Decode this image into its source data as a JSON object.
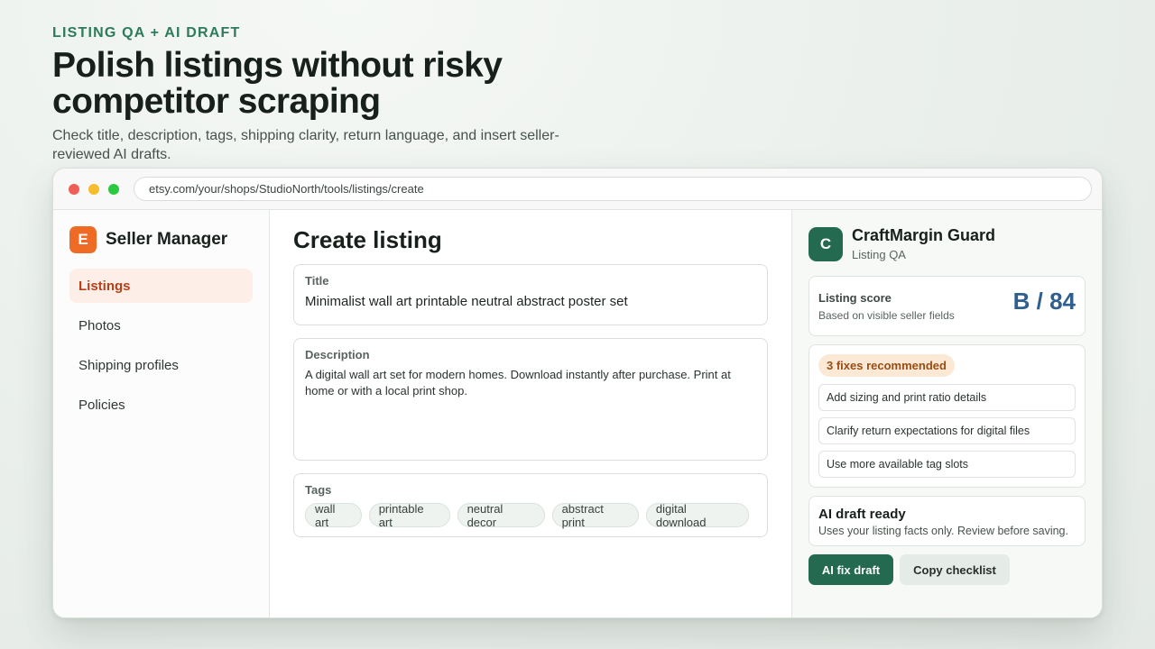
{
  "hero": {
    "eyebrow": "LISTING QA + AI DRAFT",
    "headline": "Polish listings without risky competitor scraping",
    "subhead": "Check title, description, tags, shipping clarity, return language, and insert seller-reviewed AI drafts."
  },
  "browser": {
    "url": "etsy.com/your/shops/StudioNorth/tools/listings/create"
  },
  "sidebar": {
    "logo_letter": "E",
    "brand": "Seller Manager",
    "items": [
      {
        "label": "Listings",
        "active": true
      },
      {
        "label": "Photos",
        "active": false
      },
      {
        "label": "Shipping profiles",
        "active": false
      },
      {
        "label": "Policies",
        "active": false
      }
    ]
  },
  "main": {
    "title": "Create listing",
    "title_field": {
      "label": "Title",
      "value": "Minimalist wall art printable neutral abstract poster set"
    },
    "description_field": {
      "label": "Description",
      "value": "A digital wall art set for modern homes. Download instantly after purchase. Print at home or with a local print shop."
    },
    "tags_field": {
      "label": "Tags",
      "tags": [
        "wall art",
        "printable art",
        "neutral decor",
        "abstract print",
        "digital download"
      ]
    }
  },
  "panel": {
    "logo_letter": "C",
    "title": "CraftMargin Guard",
    "subtitle": "Listing QA",
    "score": {
      "label": "Listing score",
      "sub": "Based on visible seller fields",
      "value": "B / 84"
    },
    "fixes": {
      "badge": "3 fixes recommended",
      "items": [
        "Add sizing and print ratio details",
        "Clarify return expectations for digital files",
        "Use more available tag slots"
      ]
    },
    "draft": {
      "title": "AI draft ready",
      "sub": "Uses your listing facts only. Review before saving."
    },
    "buttons": {
      "primary": "AI fix draft",
      "secondary": "Copy checklist"
    }
  },
  "colors": {
    "accent_green": "#236a50",
    "brand_orange": "#ef6a24",
    "score_blue": "#2e5f8e",
    "badge_bg": "#fbe9d6"
  }
}
